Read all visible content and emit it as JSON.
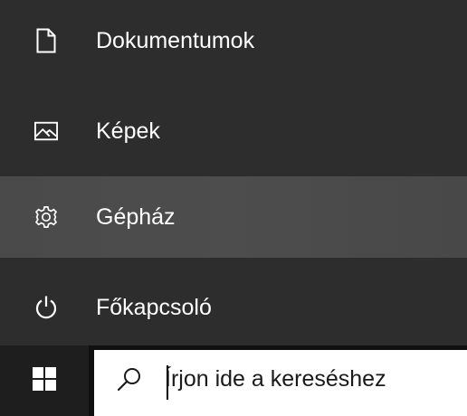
{
  "start_menu": {
    "items": [
      {
        "label": "Dokumentumok",
        "icon": "document-icon"
      },
      {
        "label": "Képek",
        "icon": "pictures-icon"
      },
      {
        "label": "Gépház",
        "icon": "gear-icon"
      },
      {
        "label": "Főkapcsoló",
        "icon": "power-icon"
      }
    ],
    "hovered_item": "Gépház"
  },
  "taskbar": {
    "start_icon": "windows-logo-icon",
    "search": {
      "icon": "search-icon",
      "placeholder": "Írjon ide a kereséshez"
    }
  },
  "colors": {
    "menu_background": "#2d2d2d",
    "menu_hover": "#4a4a4a",
    "taskbar_background": "#101010",
    "text": "#ffffff"
  }
}
